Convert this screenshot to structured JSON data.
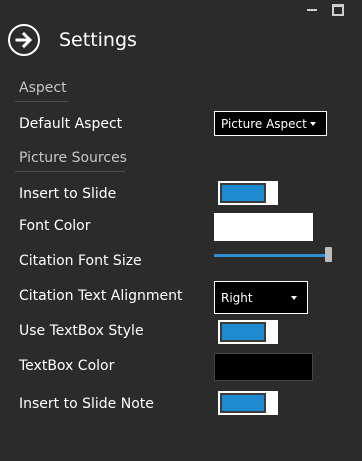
{
  "window": {
    "title": "Settings"
  },
  "sections": {
    "aspect": "Aspect",
    "picture_sources": "Picture Sources"
  },
  "settings": {
    "default_aspect": {
      "label": "Default Aspect",
      "value": "Picture Aspect"
    },
    "insert_to_slide": {
      "label": "Insert to Slide",
      "on": true
    },
    "font_color": {
      "label": "Font Color",
      "color": "#ffffff"
    },
    "citation_font_size": {
      "label": "Citation Font Size",
      "level": 1.0
    },
    "citation_text_alignment": {
      "label": "Citation Text Alignment",
      "value": "Right"
    },
    "use_textbox_style": {
      "label": "Use TextBox Style",
      "on": true
    },
    "textbox_color": {
      "label": "TextBox Color",
      "color": "#000000"
    },
    "insert_to_slide_note": {
      "label": "Insert to Slide Note",
      "on": true
    }
  },
  "colors": {
    "background": "#2b2b2b",
    "accent": "#1e8ad0"
  },
  "icons": {
    "back": "arrow-right-circle-icon",
    "minimize": "minimize-icon",
    "maximize": "maximize-icon"
  }
}
